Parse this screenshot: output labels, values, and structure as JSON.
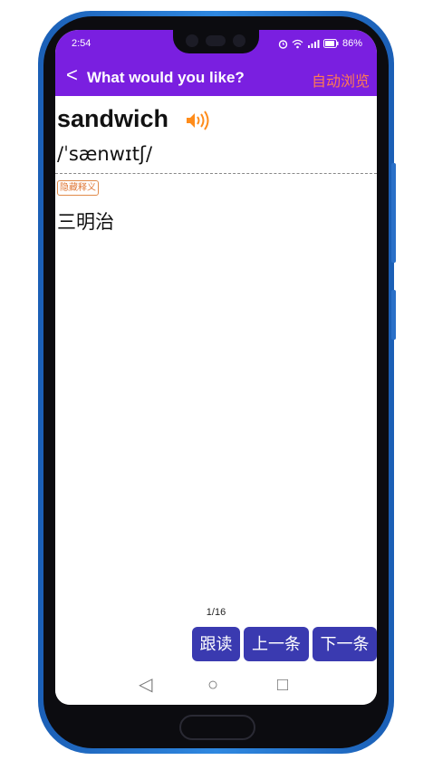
{
  "status": {
    "time": "2:54",
    "icons": "⏰ ≈ ⺆⺆.⺆⺆ ▭",
    "battery": "86%"
  },
  "appbar": {
    "back": "<",
    "title": "What would you like?",
    "action": "自动浏览"
  },
  "card": {
    "word": "sandwich",
    "phonetic": "/ˈsænwɪtʃ/",
    "hide_meaning": "隐藏释义",
    "meaning": "三明治"
  },
  "pager": {
    "counter": "1/16"
  },
  "buttons": {
    "follow": "跟读",
    "prev": "上一条",
    "next": "下一条"
  },
  "navbar": {
    "back": "◁",
    "home": "○",
    "recents": "□"
  },
  "colors": {
    "appbar": "#7a1fe0",
    "button": "#3a3ab0",
    "accent": "#ff7a52",
    "speaker": "#ff8c1a"
  }
}
